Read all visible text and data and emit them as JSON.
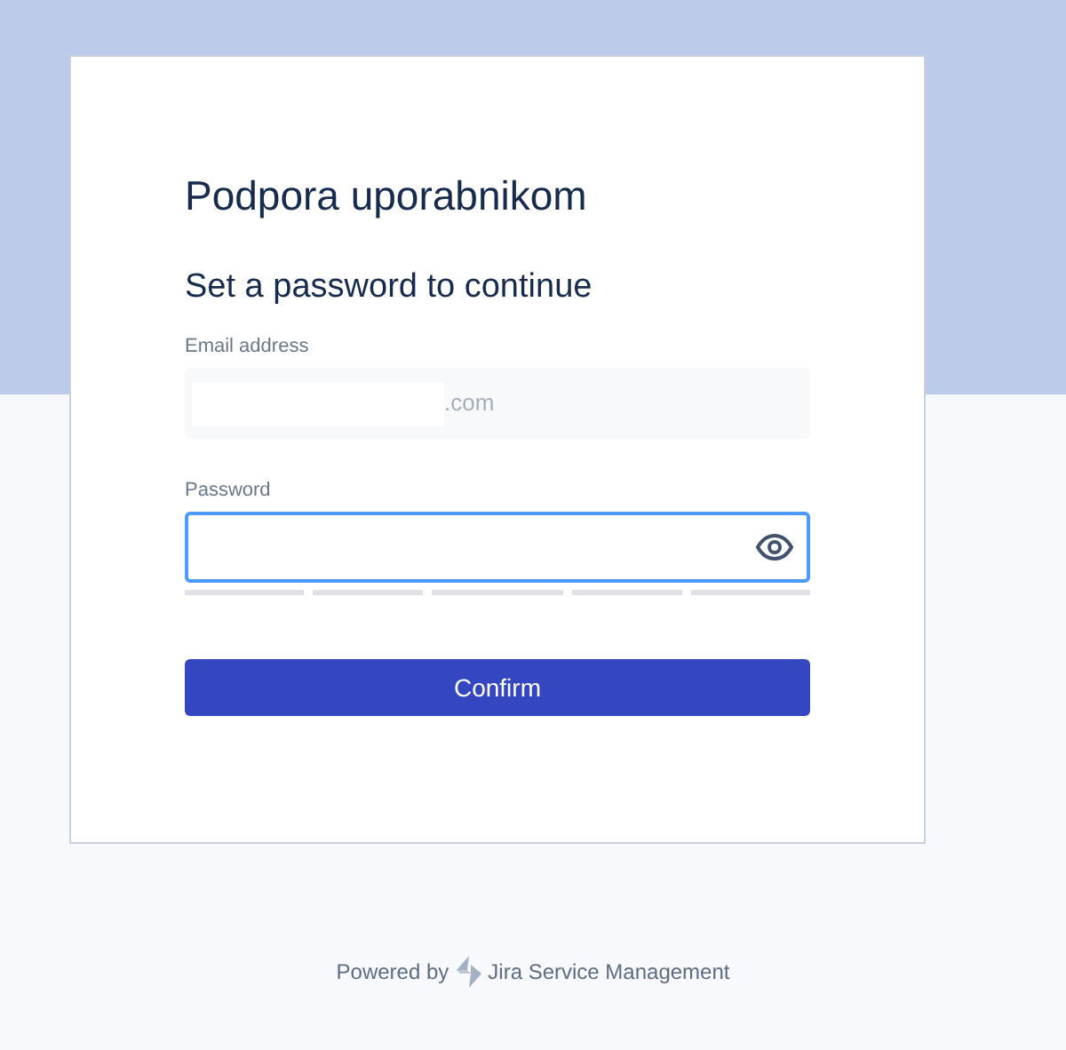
{
  "card": {
    "title": "Podpora uporabnikom",
    "heading": "Set a password to continue",
    "email": {
      "label": "Email address",
      "value": ".com",
      "disabled": true
    },
    "password": {
      "label": "Password",
      "focused": true
    },
    "confirm_button": "Confirm"
  },
  "footer": {
    "prefix": "Powered by",
    "product": "Jira Service Management"
  }
}
